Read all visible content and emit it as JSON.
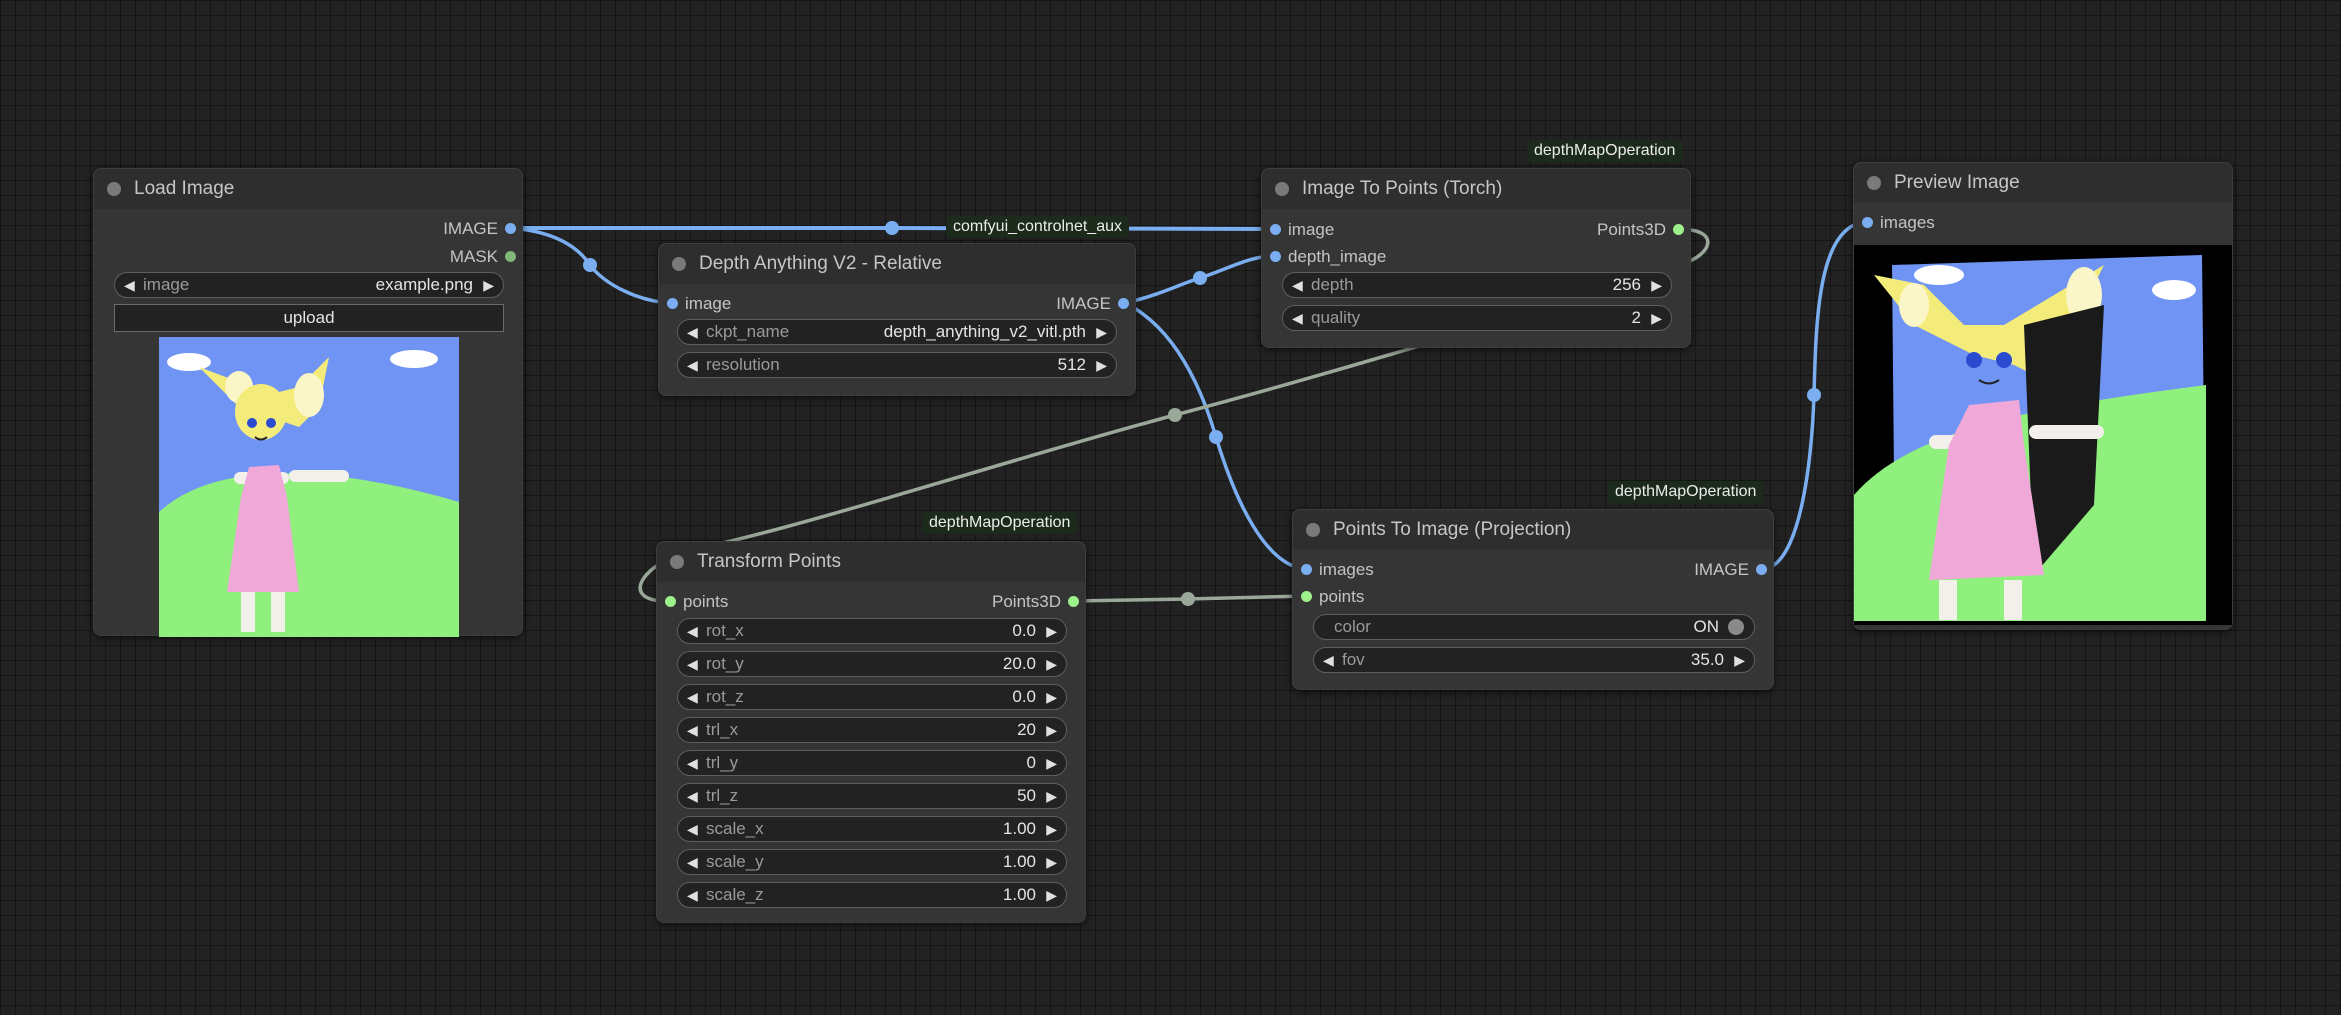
{
  "nodes": {
    "load_image": {
      "title": "Load Image",
      "outputs": [
        "IMAGE",
        "MASK"
      ],
      "image_widget": {
        "label": "image",
        "value": "example.png"
      },
      "upload_label": "upload"
    },
    "depth_anything": {
      "title": "Depth Anything V2 - Relative",
      "input": "image",
      "output": "IMAGE",
      "widgets": [
        {
          "label": "ckpt_name",
          "value": "depth_anything_v2_vitl.pth"
        },
        {
          "label": "resolution",
          "value": "512"
        }
      ]
    },
    "image_to_points": {
      "title": "Image To Points (Torch)",
      "badge": "depthMapOperation",
      "inputs": [
        "image",
        "depth_image"
      ],
      "output": "Points3D",
      "widgets": [
        {
          "label": "depth",
          "value": "256"
        },
        {
          "label": "quality",
          "value": "2"
        }
      ]
    },
    "preview_image": {
      "title": "Preview Image",
      "input": "images"
    },
    "transform_points": {
      "title": "Transform Points",
      "badge": "depthMapOperation",
      "input": "points",
      "output": "Points3D",
      "widgets": [
        {
          "label": "rot_x",
          "value": "0.0"
        },
        {
          "label": "rot_y",
          "value": "20.0"
        },
        {
          "label": "rot_z",
          "value": "0.0"
        },
        {
          "label": "trl_x",
          "value": "20"
        },
        {
          "label": "trl_y",
          "value": "0"
        },
        {
          "label": "trl_z",
          "value": "50"
        },
        {
          "label": "scale_x",
          "value": "1.00"
        },
        {
          "label": "scale_y",
          "value": "1.00"
        },
        {
          "label": "scale_z",
          "value": "1.00"
        }
      ]
    },
    "points_to_image": {
      "title": "Points To Image (Projection)",
      "badge": "depthMapOperation",
      "inputs": [
        "images",
        "points"
      ],
      "output": "IMAGE",
      "toggle": {
        "label": "color",
        "value": "ON"
      },
      "widgets": [
        {
          "label": "fov",
          "value": "35.0"
        }
      ]
    }
  },
  "link_badge": "comfyui_controlnet_aux",
  "colors": {
    "canvas": "#222222",
    "node_body": "#353535",
    "image_link": "#7aaef0",
    "points_link": "#9aa89a",
    "points_slot": "#9ef08c",
    "badge_bg": "#1b2a1b"
  }
}
